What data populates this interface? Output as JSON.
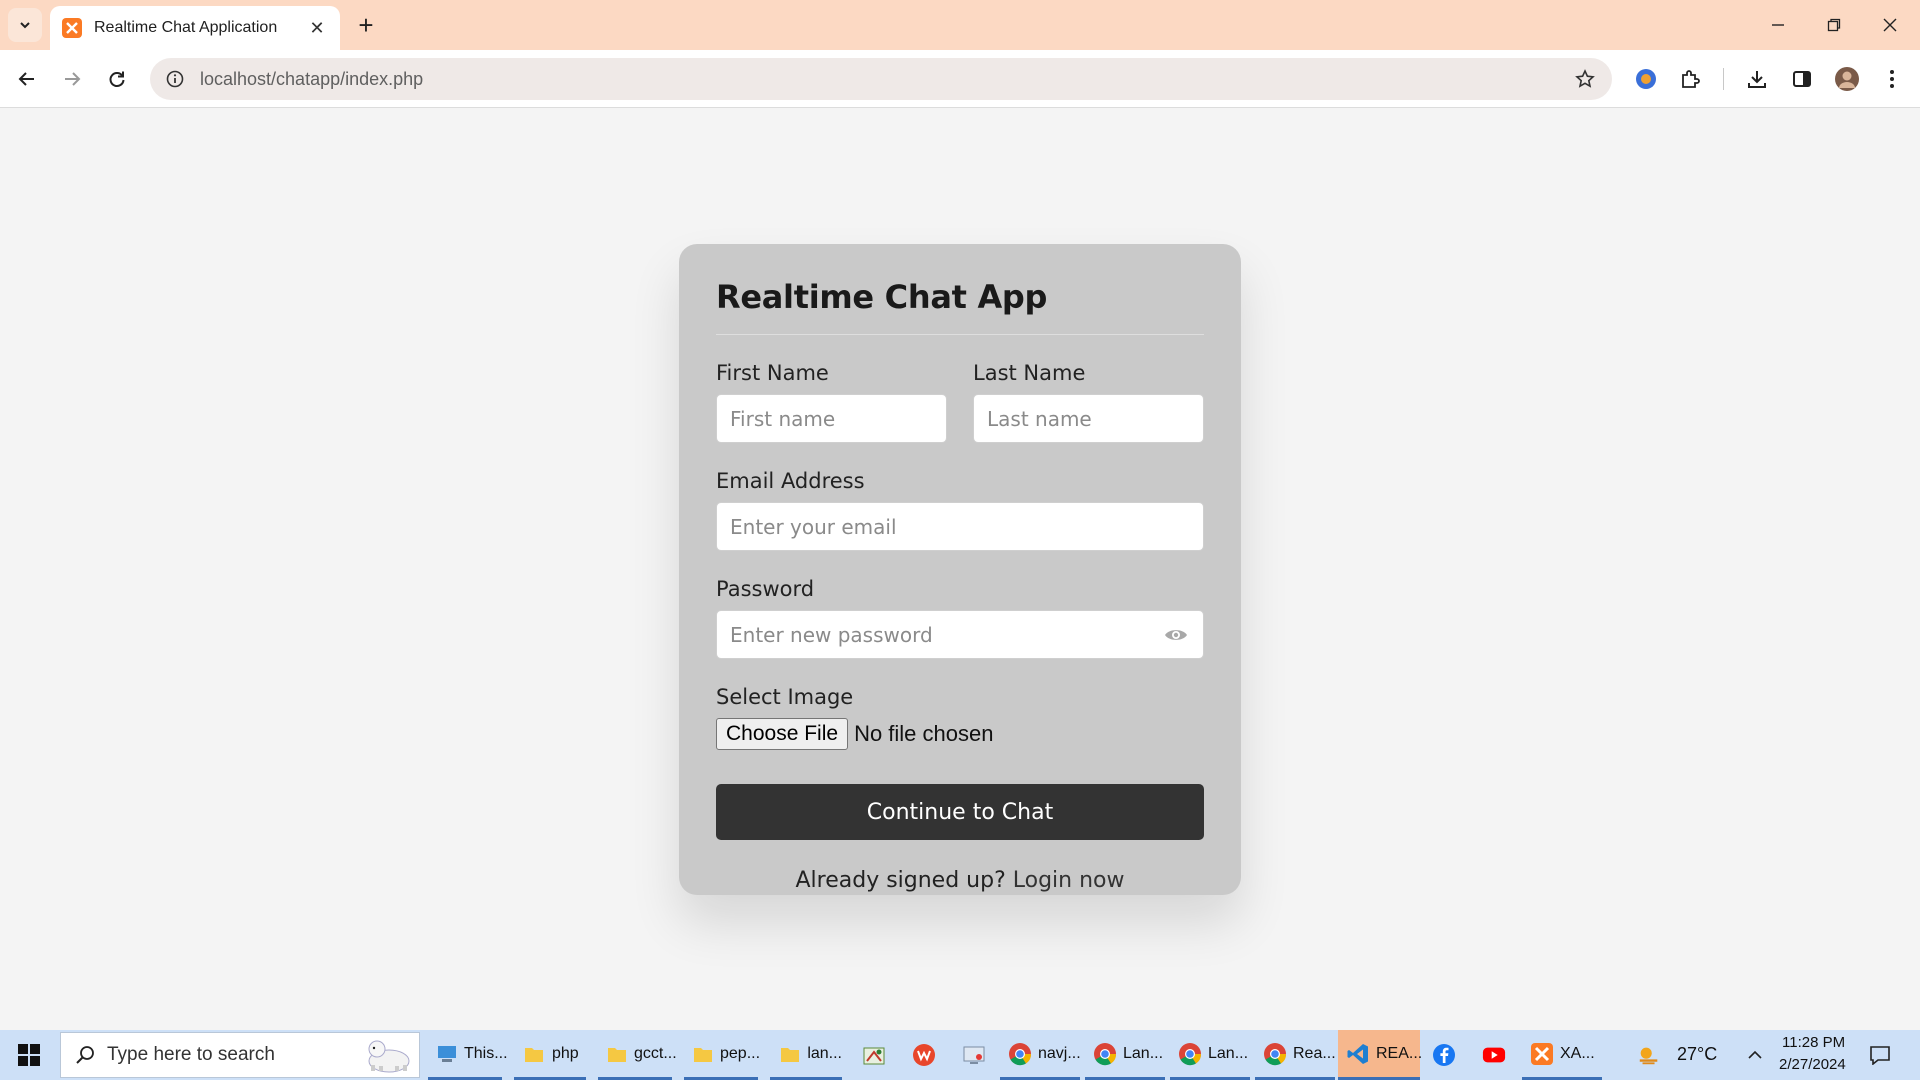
{
  "browser": {
    "tab_title": "Realtime Chat Application",
    "tab_close": "✕",
    "new_tab": "+",
    "url": "localhost/chatapp/index.php"
  },
  "page": {
    "title": "Realtime Chat App",
    "fields": {
      "first_name": {
        "label": "First Name",
        "placeholder": "First name"
      },
      "last_name": {
        "label": "Last Name",
        "placeholder": "Last name"
      },
      "email": {
        "label": "Email Address",
        "placeholder": "Enter your email"
      },
      "password": {
        "label": "Password",
        "placeholder": "Enter new password"
      },
      "image": {
        "label": "Select Image",
        "button": "Choose File",
        "status": "No file chosen"
      }
    },
    "submit_label": "Continue to Chat",
    "signup_prompt": "Already signed up?",
    "login_link": "Login now"
  },
  "taskbar": {
    "search_placeholder": "Type here to search",
    "items": [
      {
        "label": "This...",
        "icon": "computer-icon"
      },
      {
        "label": "php",
        "icon": "folder-icon"
      },
      {
        "label": "gcct...",
        "icon": "folder-icon"
      },
      {
        "label": "pep...",
        "icon": "folder-icon"
      },
      {
        "label": "lan...",
        "icon": "folder-icon"
      },
      {
        "label": "",
        "icon": "paint-icon"
      },
      {
        "label": "",
        "icon": "wps-icon"
      },
      {
        "label": "",
        "icon": "screen-icon"
      },
      {
        "label": "navj...",
        "icon": "chrome-icon"
      },
      {
        "label": "Lan...",
        "icon": "chrome-icon"
      },
      {
        "label": "Lan...",
        "icon": "chrome-icon"
      },
      {
        "label": "Rea...",
        "icon": "chrome-icon"
      },
      {
        "label": "REA...",
        "icon": "vscode-icon"
      },
      {
        "label": "",
        "icon": "facebook-icon"
      },
      {
        "label": "",
        "icon": "youtube-icon"
      },
      {
        "label": "XA...",
        "icon": "xampp-icon"
      }
    ],
    "weather": "27°C",
    "time": "11:28 PM",
    "date": "2/27/2024"
  },
  "colors": {
    "tabbar": "#fcd9c3",
    "card": "#c9c9c9",
    "button": "#333333",
    "taskbar": "#cde0f7",
    "active_task": "#f6b78d"
  }
}
